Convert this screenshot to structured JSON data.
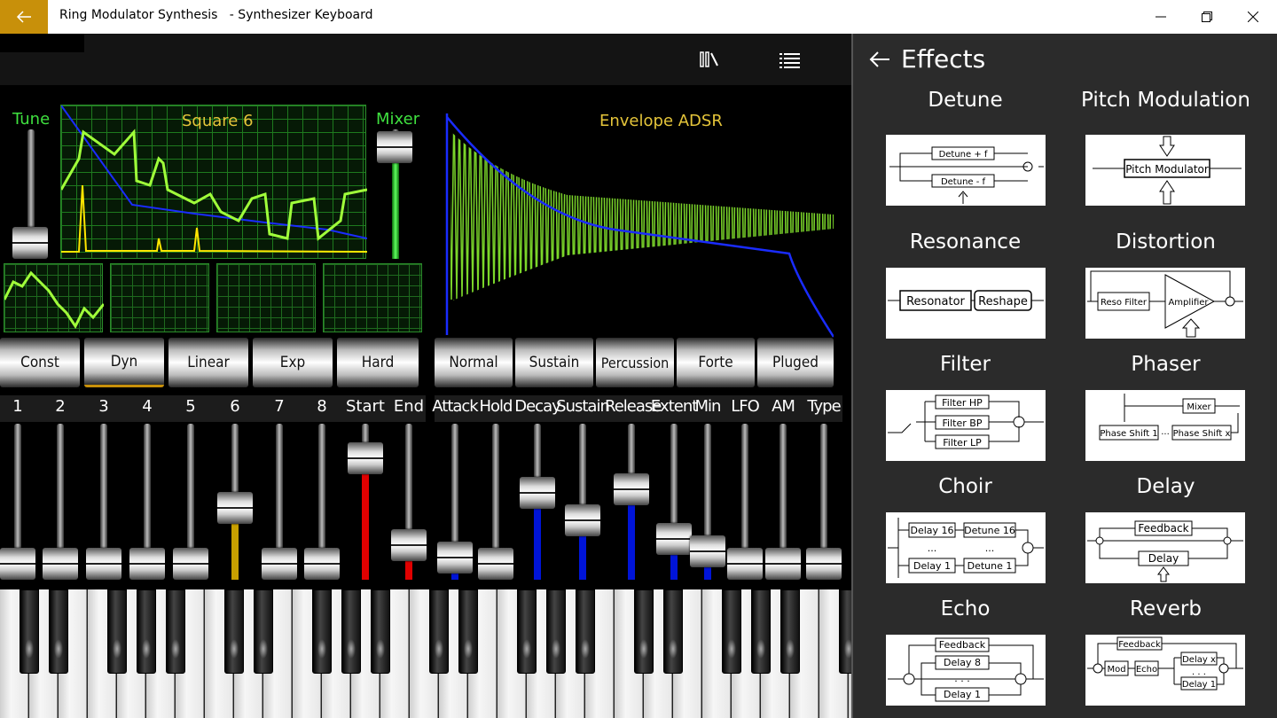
{
  "window": {
    "title": "Ring Modulator Synthesis   - Synthesizer Keyboard"
  },
  "scope": {
    "tune_label": "Tune",
    "wave_label": "Square 6",
    "mixer_label": "Mixer",
    "envelope_label": "Envelope ADSR"
  },
  "mode_buttons": [
    "Const",
    "Dyn",
    "Linear",
    "Exp",
    "Hard"
  ],
  "style_buttons": [
    "Normal",
    "Sustain",
    "Percussion",
    "Forte",
    "Pluged"
  ],
  "harmonic_labels": [
    "1",
    "2",
    "3",
    "4",
    "5",
    "6",
    "7",
    "8",
    "Start",
    "End"
  ],
  "envelope_labels": [
    "Attack",
    "Hold",
    "Decay",
    "Sustain",
    "Release",
    "Extent",
    "Min",
    "LFO",
    "AM",
    "Type"
  ],
  "slider_levels": {
    "harmonics": [
      0,
      0,
      0,
      0,
      0,
      0.45,
      0,
      0,
      0.85,
      0.15
    ],
    "envelope": [
      0.05,
      0,
      0.57,
      0.35,
      0.6,
      0.2,
      0.1,
      0,
      0,
      0
    ],
    "tune": 0.1,
    "mixer": 0.9
  },
  "effects": {
    "title": "Effects",
    "items": [
      {
        "name": "Detune",
        "labels": [
          "Detune + f",
          "Detune - f"
        ]
      },
      {
        "name": "Pitch Modulation",
        "labels": [
          "Pitch Modulator"
        ]
      },
      {
        "name": "Resonance",
        "labels": [
          "Resonator",
          "Reshape"
        ]
      },
      {
        "name": "Distortion",
        "labels": [
          "Reso Filter",
          "Amplifier"
        ]
      },
      {
        "name": "Filter",
        "labels": [
          "Filter HP",
          "Filter BP",
          "Filter LP"
        ]
      },
      {
        "name": "Phaser",
        "labels": [
          "Mixer",
          "Phase Shift 1",
          "Phase Shift x",
          "..."
        ]
      },
      {
        "name": "Choir",
        "labels": [
          "Delay 16",
          "Detune 16",
          "...",
          "Delay 1",
          "Detune 1"
        ]
      },
      {
        "name": "Delay",
        "labels": [
          "Feedback",
          "Delay"
        ]
      },
      {
        "name": "Echo",
        "labels": [
          "Feedback",
          "Delay 8",
          ". . .",
          "Delay 1"
        ]
      },
      {
        "name": "Reverb",
        "labels": [
          "Feedback",
          "Mod",
          "Echo",
          "Delay x",
          ". . .",
          "Delay 1"
        ]
      }
    ]
  },
  "colors": {
    "accent": "#c8900a",
    "scope_green": "#3fe03f",
    "scope_yellow": "#e5c53a",
    "red_fill": "#e00000",
    "blue_fill": "#0014d8",
    "gold_fill": "#c8a000"
  }
}
